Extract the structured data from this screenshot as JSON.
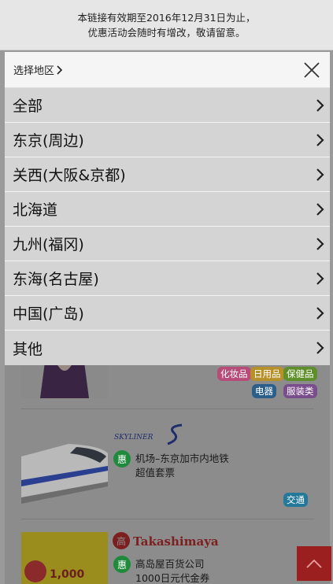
{
  "notice": {
    "line1": "本链接有效期至2016年12月31日为止，",
    "line2": "优惠活动会随时有增改，敬请留意。"
  },
  "region_panel": {
    "select_label": "选择地区",
    "chevron_icon": "chevron-right-icon",
    "close_icon": "close-icon",
    "items": [
      {
        "label": "全部"
      },
      {
        "label": "东京(周边)"
      },
      {
        "label": "关西(大阪&京都)"
      },
      {
        "label": "北海道"
      },
      {
        "label": "九州(福冈)"
      },
      {
        "label": "东海(名古屋)"
      },
      {
        "label": "中国(广岛)"
      },
      {
        "label": "其他"
      }
    ]
  },
  "listings": [
    {
      "tags": [
        {
          "label": "化妆品",
          "color": "#b84b78"
        },
        {
          "label": "日用品",
          "color": "#b8902a"
        },
        {
          "label": "保健品",
          "color": "#5f8f2a"
        },
        {
          "label": "电器",
          "color": "#2c5e8a"
        },
        {
          "label": "服装类",
          "color": "#7a4d8c"
        }
      ]
    },
    {
      "badge": "惠",
      "brand": "SKYLINER",
      "desc_line1": "机场–东京加市内地铁",
      "desc_line2": "超值套票",
      "tags": [
        {
          "label": "交通",
          "color": "#24789a"
        }
      ]
    },
    {
      "badge": "惠",
      "brand": "Takashimaya",
      "desc_line1": "高岛屋百货公司",
      "desc_line2": "1000日元代金券",
      "coupon_text": "1,000"
    }
  ],
  "to_top_icon": "chevron-up-icon",
  "colors": {
    "accent_red": "#9c1f1f",
    "badge_green": "#1f8a3b"
  }
}
